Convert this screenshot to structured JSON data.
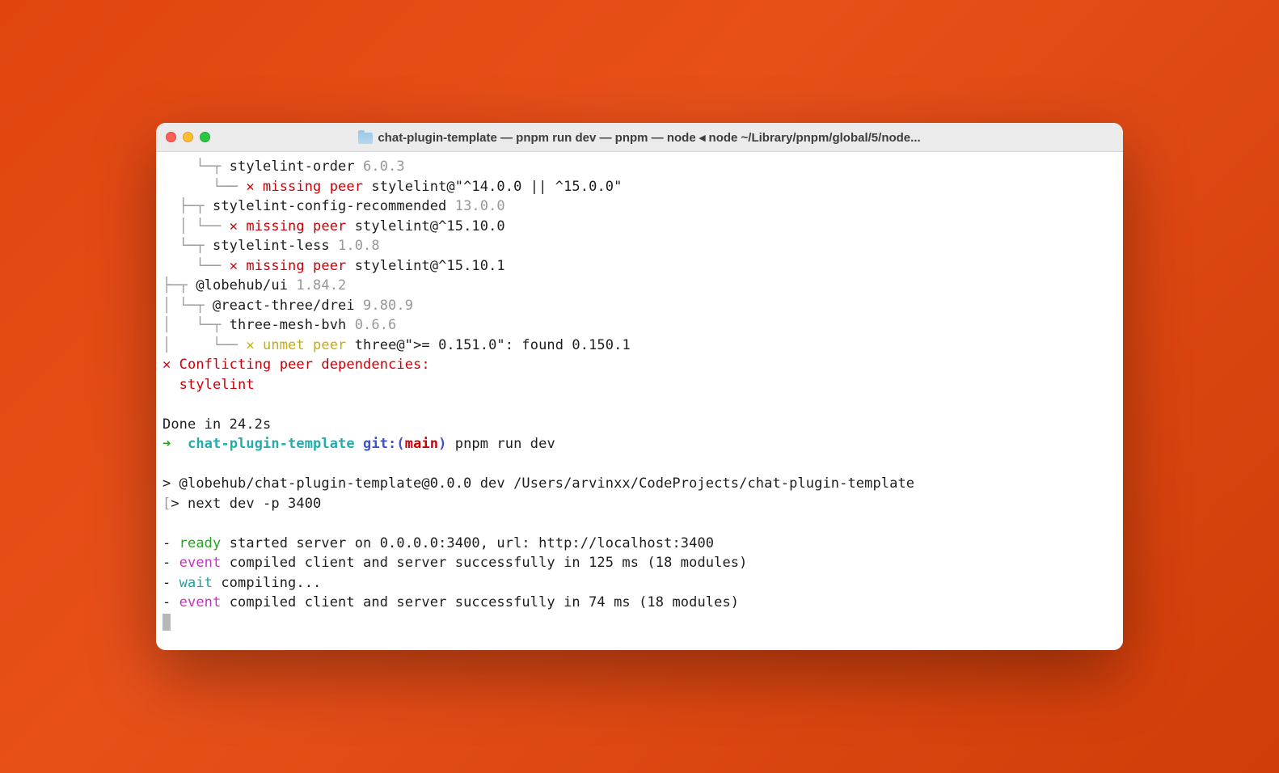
{
  "window": {
    "title": "chat-plugin-template — pnpm run dev — pnpm — node ◂ node ~/Library/pnpm/global/5/node..."
  },
  "tree": {
    "l1_pre": "    └─┬ ",
    "l1_name": "stylelint-order ",
    "l1_ver": "6.0.3",
    "l2_pre": "      └── ",
    "l2_err": "✕ missing peer",
    "l2_msg": " stylelint@\"^14.0.0 || ^15.0.0\"",
    "l3_pre": "  ├─┬ ",
    "l3_name": "stylelint-config-recommended ",
    "l3_ver": "13.0.0",
    "l4_pre": "  │ └── ",
    "l4_err": "✕ missing peer",
    "l4_msg": " stylelint@^15.10.0",
    "l5_pre": "  └─┬ ",
    "l5_name": "stylelint-less ",
    "l5_ver": "1.0.8",
    "l6_pre": "    └── ",
    "l6_err": "✕ missing peer",
    "l6_msg": " stylelint@^15.10.1",
    "l7_pre": "├─┬ ",
    "l7_name": "@lobehub/ui ",
    "l7_ver": "1.84.2",
    "l8_pre": "│ └─┬ ",
    "l8_name": "@react-three/drei ",
    "l8_ver": "9.80.9",
    "l9_pre": "│   └─┬ ",
    "l9_name": "three-mesh-bvh ",
    "l9_ver": "0.6.6",
    "l10_pre": "│     └── ",
    "l10_err": "✕ unmet peer",
    "l10_msg": " three@\">= 0.151.0\": found 0.150.1",
    "conflict_x": "✕ ",
    "conflict_msg": "Conflicting peer dependencies:",
    "conflict_pkg": "  stylelint"
  },
  "done": "Done in 24.2s",
  "prompt": {
    "arrow": "➜  ",
    "dir": "chat-plugin-template",
    "git1": " git:(",
    "branch": "main",
    "git2": ")",
    "cmd": " pnpm run dev"
  },
  "run": {
    "l1": "> @lobehub/chat-plugin-template@0.0.0 dev /Users/arvinxx/CodeProjects/chat-plugin-template",
    "l2a": "[",
    "l2b": "> next dev -p 3400",
    "l2c": "]"
  },
  "next": {
    "dash": "- ",
    "ready": "ready",
    "ready_msg": " started server on 0.0.0.0:3400, url: http://localhost:3400",
    "event": "event",
    "event1_msg": " compiled client and server successfully in 125 ms (18 modules)",
    "wait": "wait",
    "wait_msg": " compiling...",
    "event2_msg": " compiled client and server successfully in 74 ms (18 modules)"
  }
}
